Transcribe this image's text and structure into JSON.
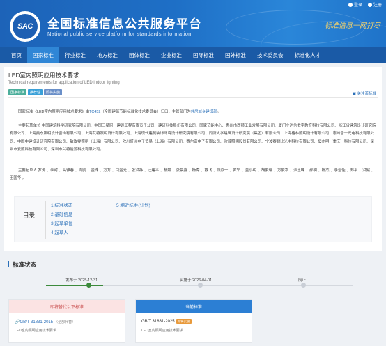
{
  "header": {
    "logo_text": "SAC",
    "title_cn": "全国标准信息公共服务平台",
    "title_en": "National public service platform  for standards information",
    "slogan": "标准信息一网打尽",
    "login": "登录",
    "register": "注册"
  },
  "nav": [
    "首页",
    "国家标准",
    "行业标准",
    "地方标准",
    "团体标准",
    "企业标准",
    "国际标准",
    "国外标准",
    "技术委员会",
    "标准化人才"
  ],
  "nav_active_index": 1,
  "standard": {
    "title": "LED室内照明应用技术要求",
    "title_en": "Technical requirements for application of LED indoor lighting",
    "badges": [
      "国家标准",
      "推荐性",
      "即将实施"
    ],
    "follow": "关注该标准",
    "para1_prefix": "国家标准《LED室内照明应用技术要求》由",
    "para1_tc": "TC452",
    "para1_mid": "（全国建筑节能标准化技术委员会）归口，主管部门为",
    "para1_dept": "住房城乡建设部",
    "para1_end": "。",
    "para2": "主要起草单位 中国建筑科学研究院有限公司、中国三星厨一建设工程有限责任公司、建研科技股份有限公司、国家节能中心、惠州市西顿工业发展有限公司、厦门立达信数字教育科技有限公司、浙江省建筑设计研究院有限公司、上海奥东照明设计咨询有限公司、上海艾特照明设计有限公司、上海现代建筑装饰环境设计研究院有限公司、同济大学建筑设计研究院（集团）有限公司、上海格林照明设计有限公司、惠州雷士光电科技有限公司、中国中建设计研究院有限公司、敏玫雯照明（上海）有限公司、欧川盛洲电子贸易（上海）有限公司、赛尔富电子有限公司、欧普照明股份有限公司、宁波赛耐比光电科技有限公司、恒亦明（重庆）科技有限公司、深圳市爱照科技有限公司、深圳市兴特能源科技有限公司。",
    "para3": "主要起草人 罗涛 、李封 、高雅春 、周鸥 、金珠 、方方 、闫金光 、张洪祎 、汪建平 、杨嫚 、张晨鑫 、杨秀 、戴飞 、顾焱一 、黄宁 、金小明 、胡俊瑞 、方俊华 、沙王峰 、郝明 、杨杰 、李治佳 、郑平 、洪健 、王国华 。"
  },
  "toc": {
    "label": "目录",
    "items_left": [
      "1  标准状态",
      "2  基础信息",
      "3  起草单位",
      "4  起草人"
    ],
    "items_right": [
      "5  相近标准(计划)"
    ]
  },
  "status": {
    "title": "标准状态",
    "timeline": [
      {
        "label": "发布于 2025-12-31",
        "done": true
      },
      {
        "label": "实施于 2026-04-01",
        "done": false
      },
      {
        "label": "废止",
        "done": false
      }
    ]
  },
  "replaced": {
    "header": "即将替代以下标准",
    "code": "GB/T 31831-2015",
    "sub": "（全部代替）",
    "desc": "LED室内照明应用技术要求"
  },
  "current": {
    "header": "当前标准",
    "code": "GB/T 31831-2025",
    "tag": "即将实施",
    "desc": "LED室内照明应用技术要求"
  },
  "colors": {
    "brand_blue": "#1d63b8",
    "nav_blue": "#1a5aa6",
    "link_blue": "#2a6fb8",
    "done_green": "#3c8a3c",
    "warn_red": "#c84b4b"
  }
}
